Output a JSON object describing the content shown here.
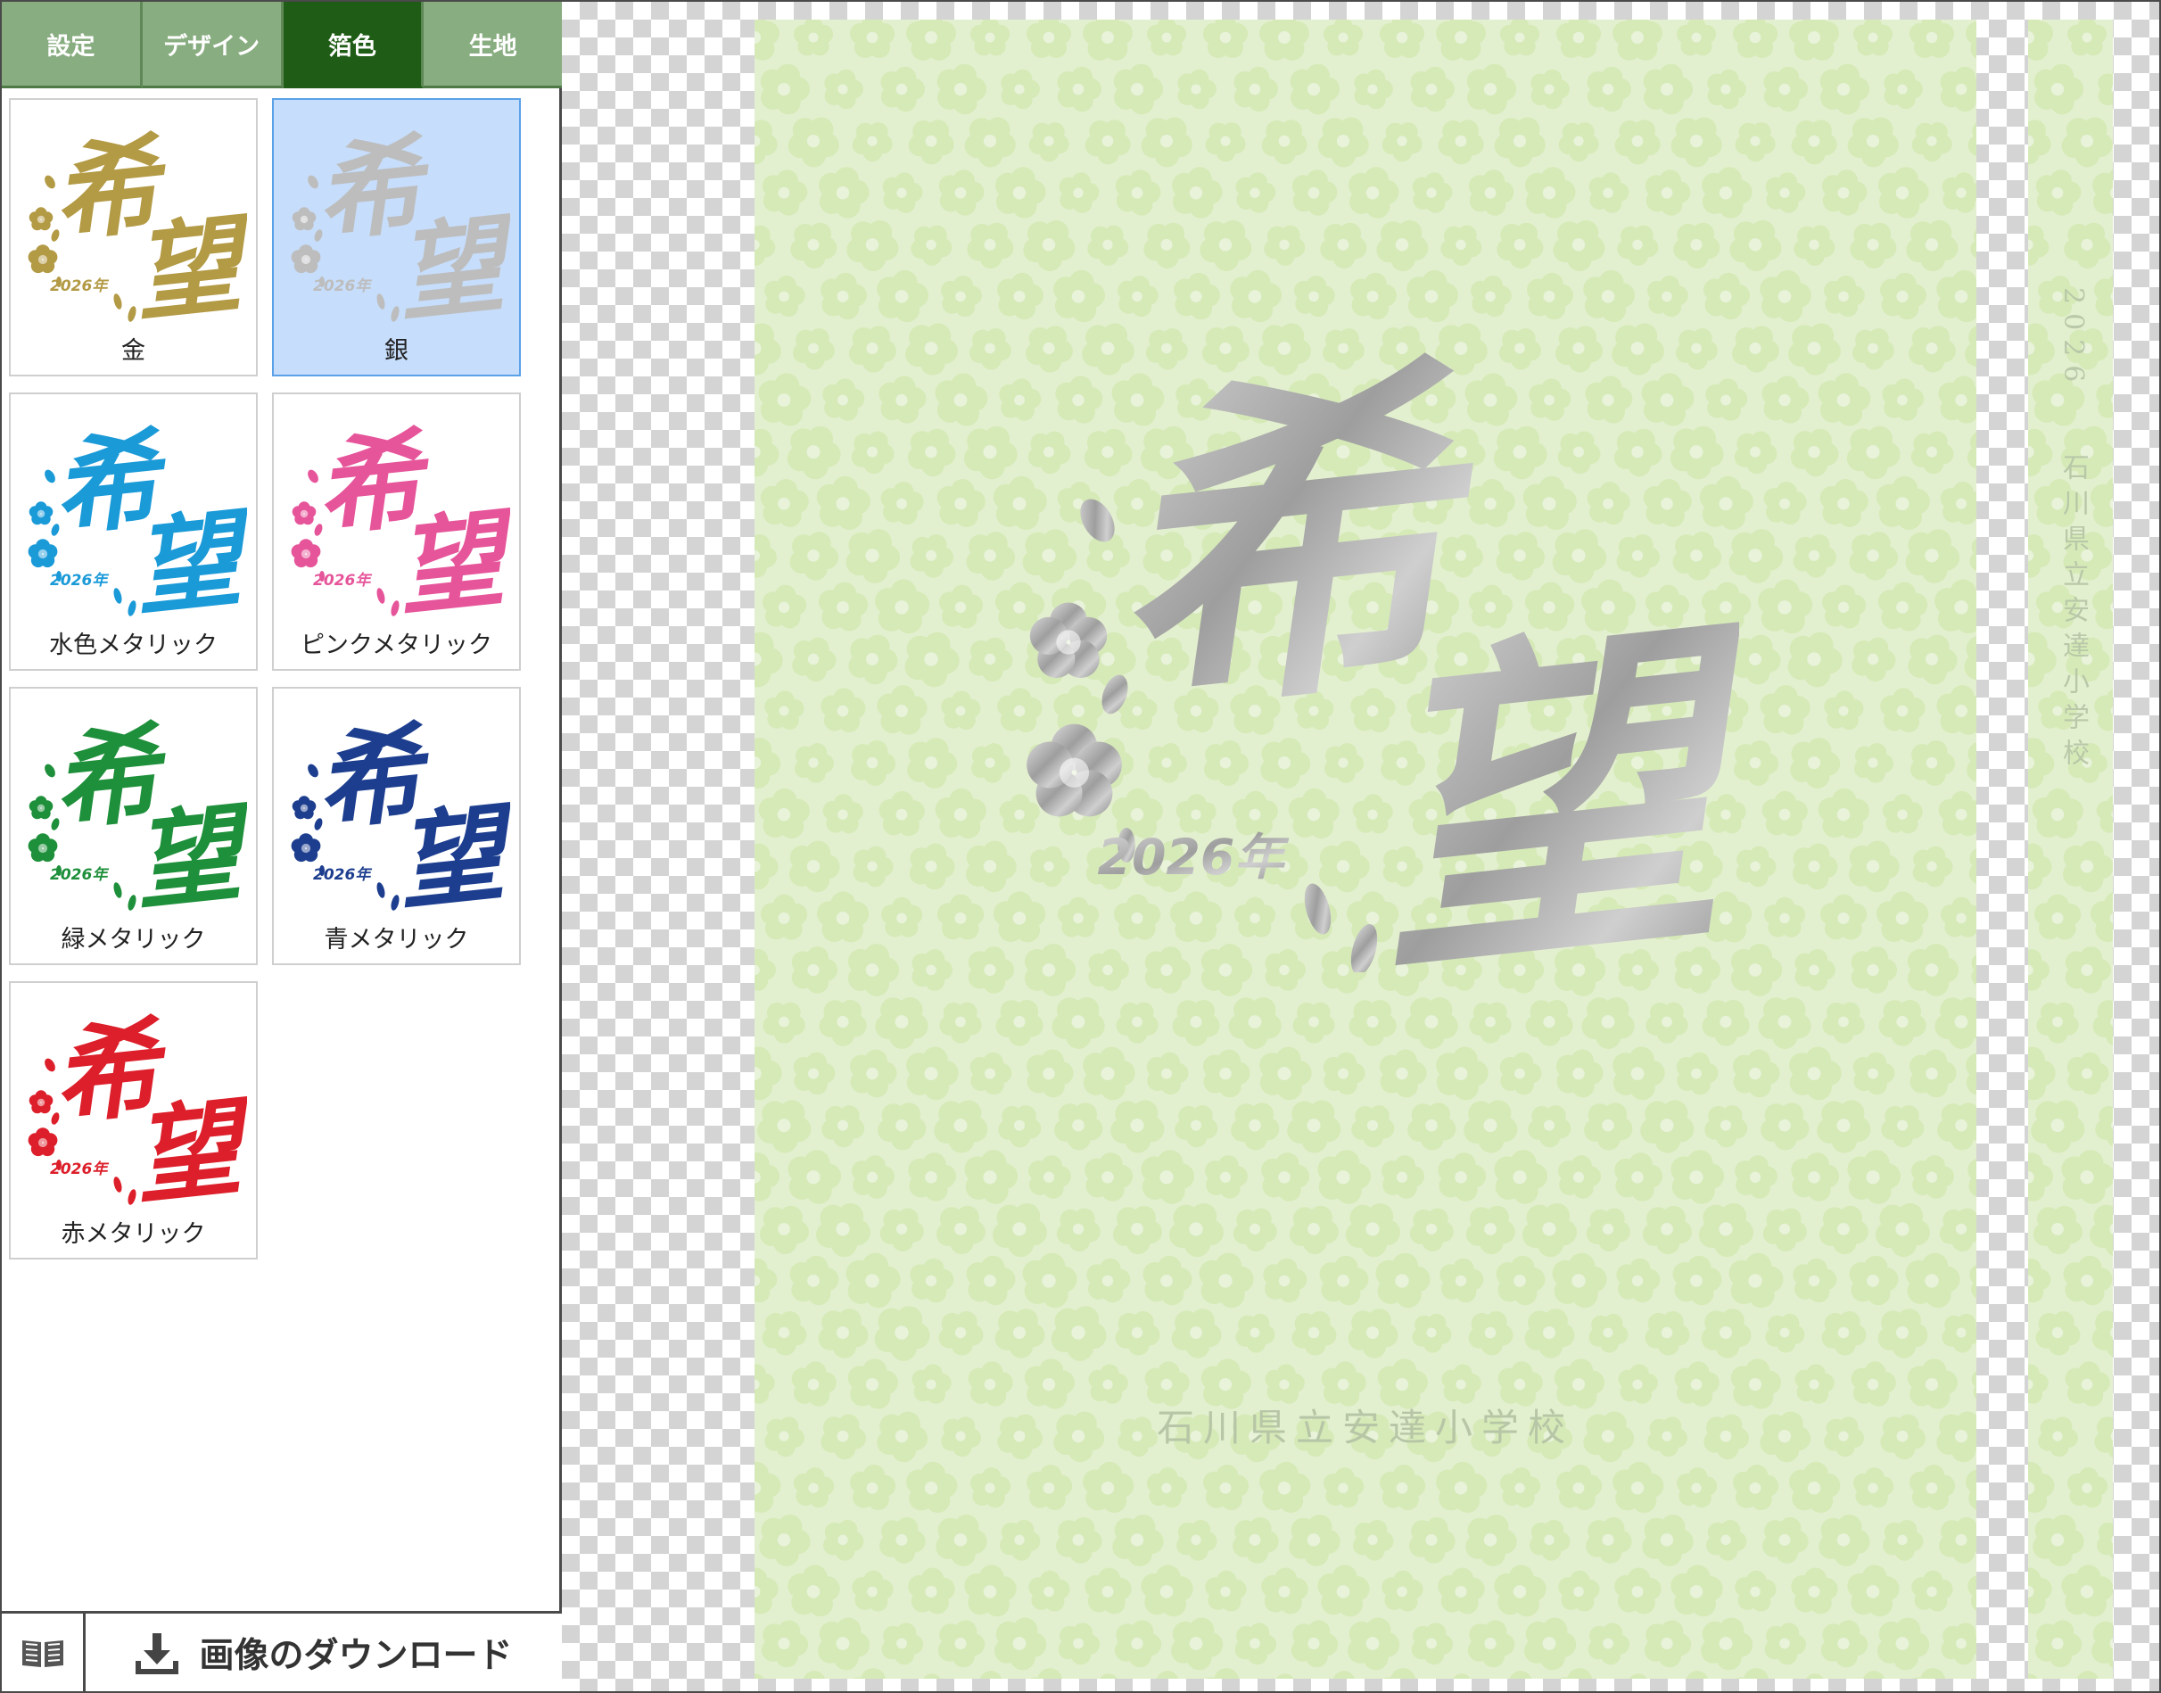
{
  "tabs": [
    {
      "label": "設定",
      "active": false
    },
    {
      "label": "デザイン",
      "active": false
    },
    {
      "label": "箔色",
      "active": true
    },
    {
      "label": "生地",
      "active": false
    }
  ],
  "emblem": {
    "text": "希望",
    "year": "2026年"
  },
  "swatches": [
    {
      "label": "金",
      "color": "#b39a45",
      "selected": false
    },
    {
      "label": "銀",
      "color": "#bdbdbd",
      "selected": true
    },
    {
      "label": "水色メタリック",
      "color": "#1b9ad8",
      "selected": false
    },
    {
      "label": "ピンクメタリック",
      "color": "#e6559a",
      "selected": false
    },
    {
      "label": "緑メタリック",
      "color": "#1e8f3a",
      "selected": false
    },
    {
      "label": "青メタリック",
      "color": "#1d3e8f",
      "selected": false
    },
    {
      "label": "赤メタリック",
      "color": "#dc1f2a",
      "selected": false
    }
  ],
  "download": {
    "label": "画像のダウンロード",
    "icon": "download-icon"
  },
  "book_icon": "book-icon",
  "cover": {
    "background": "#e3f0cf",
    "foil_color": "#b0b0b0",
    "school_name": "石川県立安達小学校",
    "spine_year": "2026",
    "spine_school": "石川県立安達小学校"
  }
}
